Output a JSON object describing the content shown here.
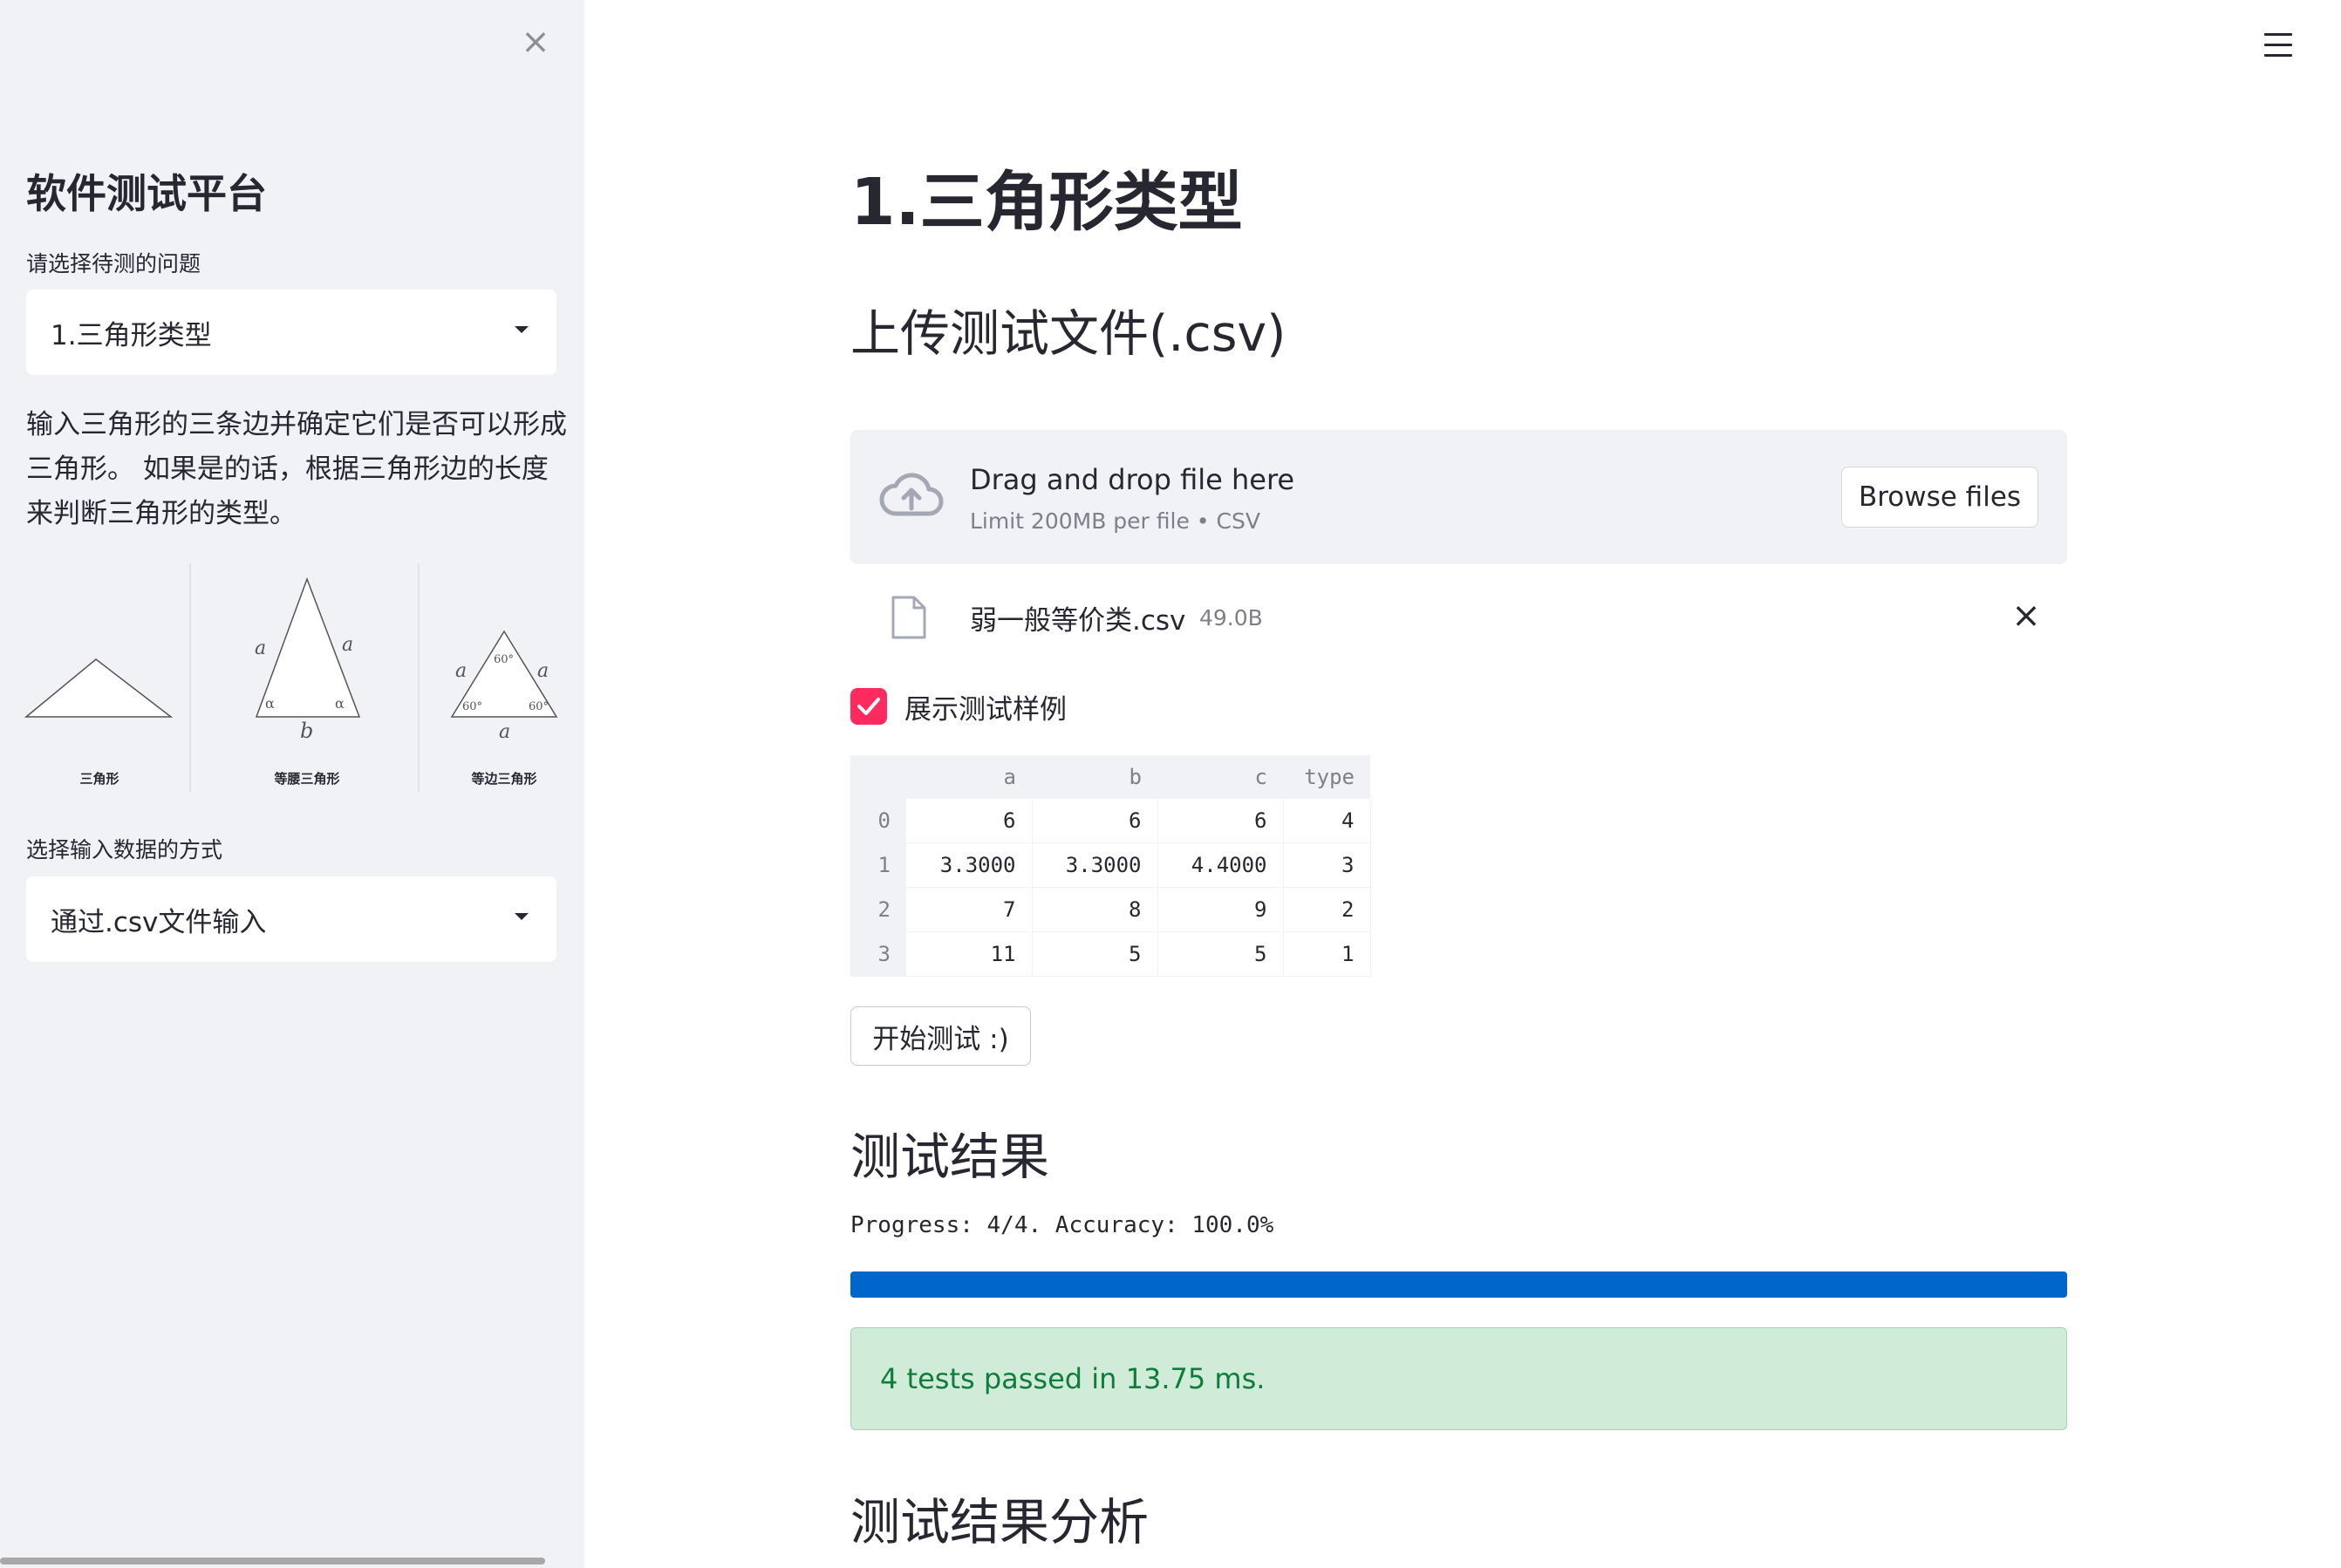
{
  "sidebar": {
    "title": "软件测试平台",
    "problem_label": "请选择待测的问题",
    "problem_selected": "1.三角形类型",
    "description": "输入三角形的三条边并确定它们是否可以形成三角形。 如果是的话，根据三角形边的长度来判断三角形的类型。",
    "figure": {
      "captions": [
        "三角形",
        "等腰三角形",
        "等边三角形"
      ],
      "isosceles_labels": {
        "side": "a",
        "base": "b",
        "angle": "α"
      },
      "equilateral_labels": {
        "side": "a",
        "angle": "60°"
      }
    },
    "input_label": "选择输入数据的方式",
    "input_selected": "通过.csv文件输入"
  },
  "main": {
    "title": "1.三角形类型",
    "upload_heading": "上传测试文件(.csv)",
    "uploader": {
      "drag_text": "Drag and drop file here",
      "limit_text": "Limit 200MB per file • CSV",
      "browse_label": "Browse files"
    },
    "file": {
      "name": "弱一般等价类.csv",
      "size": "49.0B"
    },
    "show_cases": {
      "label": "展示测试样例",
      "checked": true
    },
    "table": {
      "columns": [
        "",
        "a",
        "b",
        "c",
        "type"
      ],
      "rows": [
        [
          "0",
          "6",
          "6",
          "6",
          "4"
        ],
        [
          "1",
          "3.3000",
          "3.3000",
          "4.4000",
          "3"
        ],
        [
          "2",
          "7",
          "8",
          "9",
          "2"
        ],
        [
          "3",
          "11",
          "5",
          "5",
          "1"
        ]
      ]
    },
    "start_button": "开始测试 :)",
    "results_heading": "测试结果",
    "progress_text": "Progress: 4/4. Accuracy: 100.0%",
    "progress_fraction": 1.0,
    "success_text": "4 tests passed in 13.75 ms.",
    "analysis_heading": "测试结果分析"
  },
  "colors": {
    "sidebar_bg": "#f0f2f6",
    "accent_checkbox": "#ff2b5e",
    "progress": "#0066cc",
    "success_bg": "#d0ecd8",
    "success_text": "#0e7d3b"
  }
}
